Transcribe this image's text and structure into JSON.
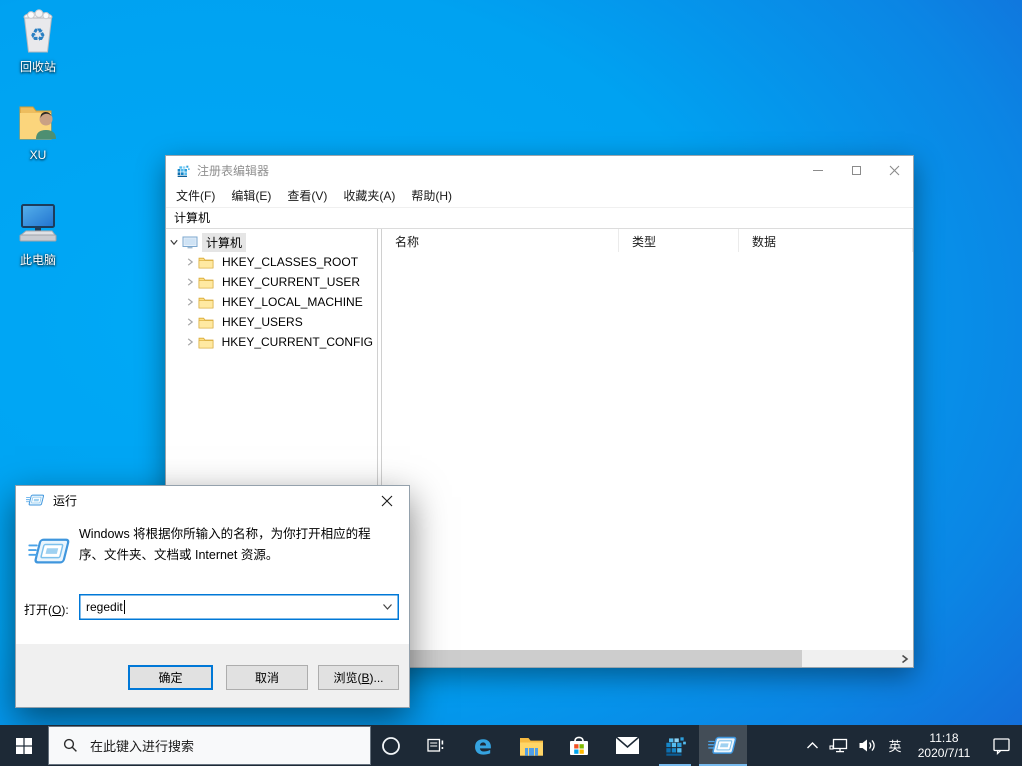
{
  "desktop": {
    "icons": [
      {
        "name": "recycle-bin",
        "label": "回收站"
      },
      {
        "name": "user-folder",
        "label": "XU"
      },
      {
        "name": "this-pc",
        "label": "此电脑"
      }
    ]
  },
  "regedit": {
    "title": "注册表编辑器",
    "menus": [
      "文件(F)",
      "编辑(E)",
      "查看(V)",
      "收藏夹(A)",
      "帮助(H)"
    ],
    "address": "计算机",
    "tree": {
      "root": "计算机",
      "children": [
        "HKEY_CLASSES_ROOT",
        "HKEY_CURRENT_USER",
        "HKEY_LOCAL_MACHINE",
        "HKEY_USERS",
        "HKEY_CURRENT_CONFIG"
      ]
    },
    "list": {
      "columns": [
        "名称",
        "类型",
        "数据"
      ],
      "rows": []
    }
  },
  "run_dialog": {
    "title": "运行",
    "description": "Windows 将根据你所输入的名称，为你打开相应的程序、文件夹、文档或 Internet 资源。",
    "open_label": "打开(O):",
    "input_value": "regedit",
    "ok_label": "确定",
    "cancel_label": "取消",
    "browse_label": "浏览(B)..."
  },
  "taskbar": {
    "search_placeholder": "在此键入进行搜索",
    "edge_glyph": "e",
    "pinned_icons": [
      "start",
      "search",
      "cortana",
      "task-view",
      "edge",
      "file-explorer",
      "store",
      "mail",
      "regedit",
      "run"
    ],
    "tray": {
      "language": "英",
      "time": "11:18",
      "date": "2020/7/11"
    }
  },
  "colors": {
    "accent": "#0078d7",
    "taskbar": "#1d2936",
    "taskbar_underline": "#76b9ed",
    "desktop_center": "#00a9f6",
    "desktop_edge": "#1b4ac8",
    "inactive_selection": "#e5e5e5"
  }
}
